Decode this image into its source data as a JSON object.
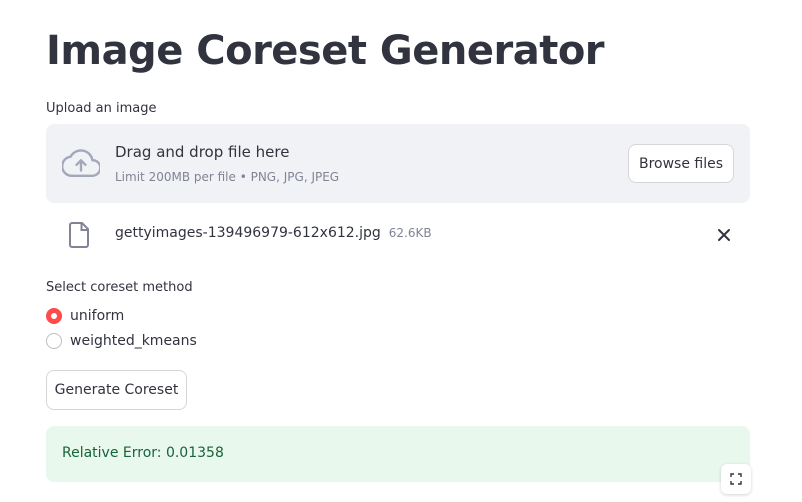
{
  "page": {
    "title": "Image Coreset Generator"
  },
  "uploader": {
    "label": "Upload an image",
    "dropzone_title": "Drag and drop file here",
    "dropzone_limit": "Limit 200MB per file • PNG, JPG, JPEG",
    "browse_label": "Browse files",
    "icon": "cloud-upload-icon"
  },
  "uploaded_file": {
    "name": "gettyimages-139496979-612x612.jpg",
    "size": "62.6KB",
    "icon": "file-icon",
    "remove_icon": "close-icon"
  },
  "method": {
    "label": "Select coreset method",
    "options": [
      {
        "label": "uniform",
        "selected": true
      },
      {
        "label": "weighted_kmeans",
        "selected": false
      }
    ]
  },
  "actions": {
    "generate_label": "Generate Coreset"
  },
  "result": {
    "message": "Relative Error: 0.01358"
  },
  "colors": {
    "accent": "#ff4b4b",
    "text": "#31333f",
    "muted": "#808495",
    "dropzone_bg": "#f0f2f6",
    "success_bg": "#e9f8ec",
    "success_text": "#17633a"
  },
  "icons": {
    "fullscreen": "fullscreen-icon"
  }
}
